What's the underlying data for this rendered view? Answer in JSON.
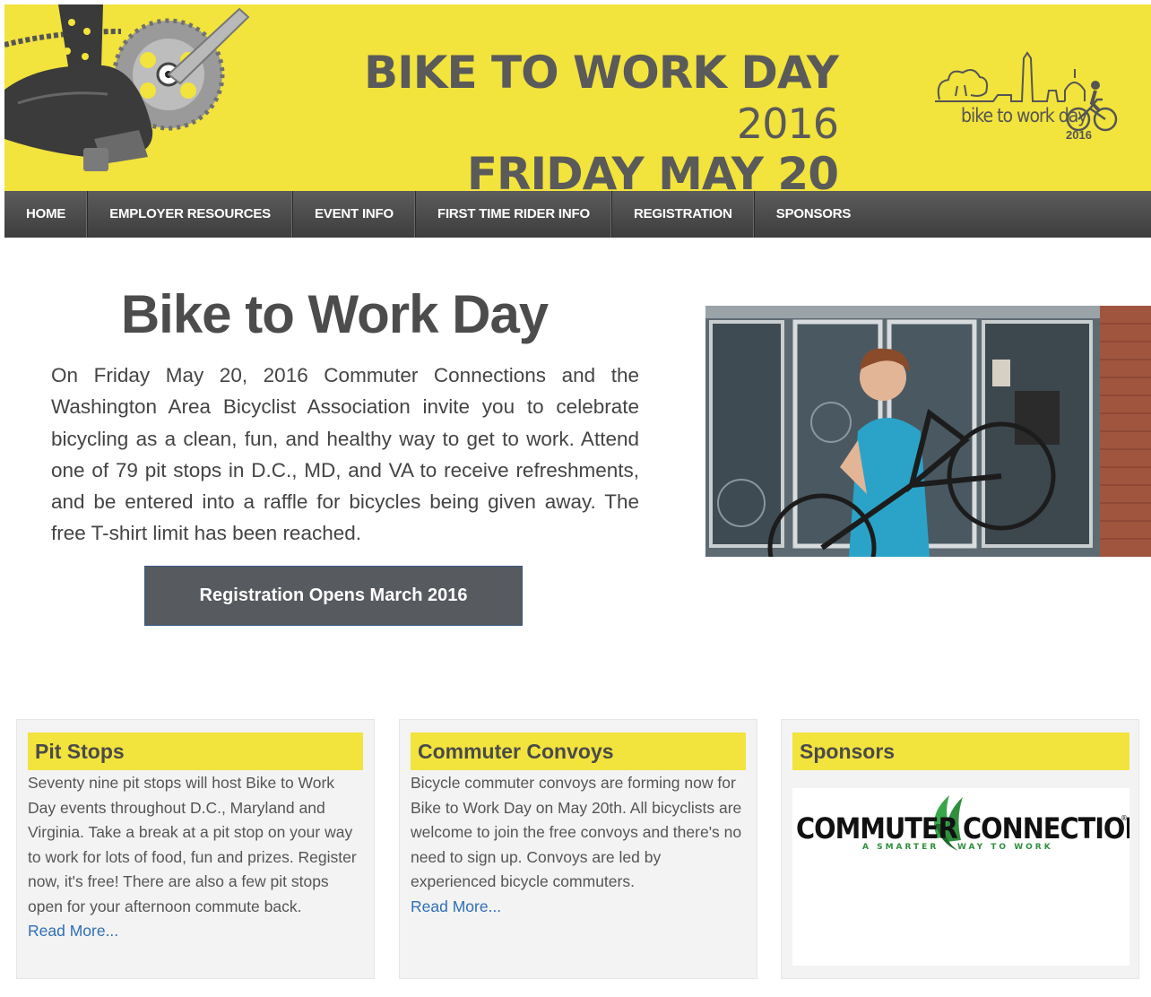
{
  "header": {
    "title_line1": "BIKE TO WORK DAY",
    "title_year": "2016",
    "title_line2": "FRIDAY MAY 20",
    "logo_text": "bike to work day",
    "logo_year": "2016"
  },
  "nav": {
    "items": [
      "HOME",
      "EMPLOYER RESOURCES",
      "EVENT INFO",
      "FIRST TIME RIDER INFO",
      "REGISTRATION",
      "SPONSORS"
    ]
  },
  "hero": {
    "title": "Bike to Work Day",
    "text": "On Friday May 20, 2016 Commuter Connections and the Washington Area Bicyclist Association invite you to celebrate bicycling as a clean, fun, and healthy way to get to work. Attend one of 79 pit stops in D.C., MD, and VA to receive refreshments, and be entered into a raffle for bicycles being given away. The free T-shirt limit has been reached.",
    "cta_label": "Registration Opens March 2016"
  },
  "cards": [
    {
      "title": "Pit Stops",
      "text": "Seventy nine pit stops will host Bike to Work Day events throughout D.C., Maryland and Virginia. Take a break at a pit stop on your way to work for lots of food, fun and prizes. Register now, it's free! There are also a few pit stops open for your afternoon commute back.",
      "link": "Read More..."
    },
    {
      "title": "Commuter Convoys",
      "text": "Bicycle commuter convoys are forming now for Bike to Work Day on May 20th. All bicyclists are welcome to join the free convoys and there's no need to sign up. Convoys are led by experienced bicycle commuters.",
      "link": "Read More..."
    },
    {
      "title": "Sponsors",
      "sponsor_logo": {
        "name_left": "COMMUTER",
        "name_right": "CONNECTIONS",
        "registered": "®",
        "tagline_left": "A SMARTER",
        "tagline_right": "WAY TO WORK"
      }
    }
  ],
  "colors": {
    "brand_yellow": "#f2e33d",
    "nav_dark": "#4a4a4a",
    "link_blue": "#2f6fb5",
    "cta_gray": "#575a5e"
  }
}
